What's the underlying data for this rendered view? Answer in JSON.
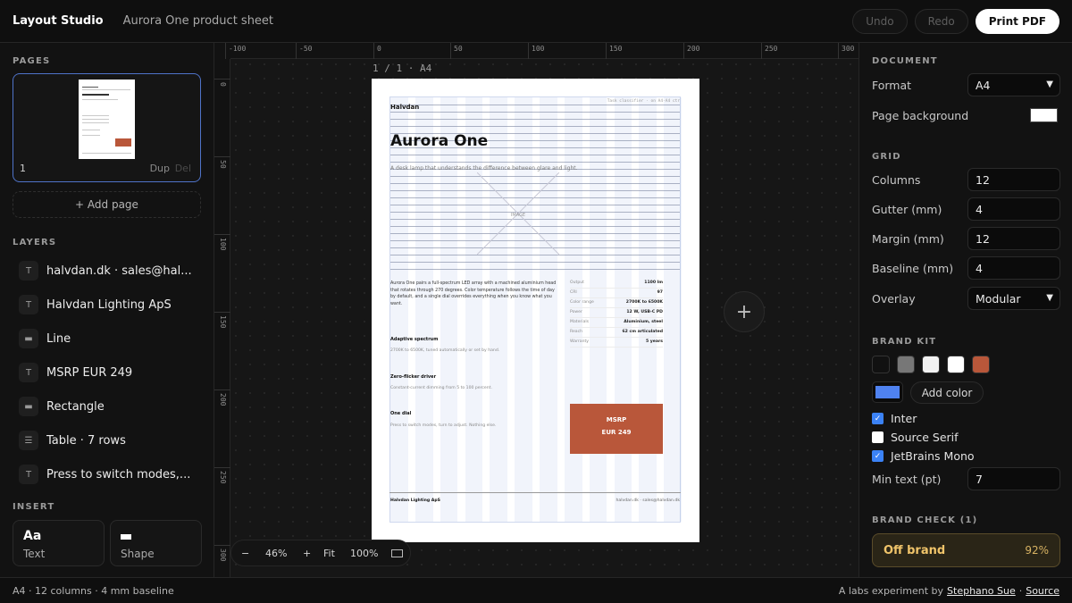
{
  "topbar": {
    "app_title": "Layout Studio",
    "doc_title": "Aurora One product sheet",
    "undo_label": "Undo",
    "redo_label": "Redo",
    "print_label": "Print PDF"
  },
  "pages": {
    "section_label": "PAGES",
    "items": [
      {
        "number": "1",
        "dup_label": "Dup",
        "del_label": "Del"
      }
    ],
    "add_label": "+ Add page"
  },
  "layers": {
    "section_label": "LAYERS",
    "items": [
      {
        "icon": "T",
        "label": "halvdan.dk · sales@hal..."
      },
      {
        "icon": "T",
        "label": "Halvdan Lighting ApS"
      },
      {
        "icon": "▬",
        "label": "Line"
      },
      {
        "icon": "T",
        "label": "MSRP EUR 249"
      },
      {
        "icon": "▬",
        "label": "Rectangle"
      },
      {
        "icon": "☰",
        "label": "Table · 7 rows"
      },
      {
        "icon": "T",
        "label": "Press to switch modes,..."
      }
    ]
  },
  "insert": {
    "section_label": "INSERT",
    "items": [
      {
        "glyph": "Aa",
        "label": "Text"
      },
      {
        "glyph": "",
        "label": "Shape"
      }
    ]
  },
  "canvas": {
    "ruler_top": [
      "-100",
      "-50",
      "0",
      "50",
      "100",
      "150",
      "200",
      "250",
      "300"
    ],
    "ruler_left": [
      "0",
      "50",
      "100",
      "150",
      "200",
      "250",
      "300"
    ],
    "page_indicator": "1 / 1 · A4",
    "fab_label": "+",
    "zoom": {
      "minus": "−",
      "value": "46%",
      "plus": "+",
      "fit": "Fit",
      "actual": "100%"
    }
  },
  "sheet": {
    "brand": "Halvdan",
    "top_right_tag": "Task classifier · on A4·A4 ctr",
    "title": "Aurora One",
    "subtitle": "A desk lamp that understands the difference between glare and light.",
    "image_label": "IMAGE",
    "body": "Aurora One pairs a full-spectrum LED array with a machined aluminium head that rotates through 270 degrees. Color temperature follows the time of day by default, and a single dial overrides everything when you know what you want.",
    "features": [
      {
        "title": "Adaptive spectrum",
        "text": "2700K to 6500K, tuned automatically or set by hand."
      },
      {
        "title": "Zero-flicker driver",
        "text": "Constant-current dimming from 5 to 100 percent."
      },
      {
        "title": "One dial",
        "text": "Press to switch modes, turn to adjust. Nothing else."
      }
    ],
    "specs": [
      {
        "label": "Output",
        "value": "1100 lm"
      },
      {
        "label": "CRI",
        "value": "97"
      },
      {
        "label": "Color range",
        "value": "2700K to 6500K"
      },
      {
        "label": "Power",
        "value": "12 W, USB-C PD"
      },
      {
        "label": "Materials",
        "value": "Aluminium, steel"
      },
      {
        "label": "Reach",
        "value": "62 cm articulated"
      },
      {
        "label": "Warranty",
        "value": "5 years"
      }
    ],
    "price_line1": "MSRP",
    "price_line2": "EUR 249",
    "footer_left": "Halvdan Lighting ApS",
    "footer_right": "halvdan.dk · sales@halvdan.dk",
    "accent_color": "#b9573a"
  },
  "document": {
    "section_label": "DOCUMENT",
    "format_label": "Format",
    "format_value": "A4",
    "background_label": "Page background",
    "background_color": "#ffffff"
  },
  "grid": {
    "section_label": "GRID",
    "columns_label": "Columns",
    "columns_value": "12",
    "gutter_label": "Gutter (mm)",
    "gutter_value": "4",
    "margin_label": "Margin (mm)",
    "margin_value": "12",
    "baseline_label": "Baseline (mm)",
    "baseline_value": "4",
    "overlay_label": "Overlay",
    "overlay_value": "Modular"
  },
  "brand_kit": {
    "section_label": "BRAND KIT",
    "swatches": [
      "#111111",
      "#777777",
      "#f2f2f2",
      "#ffffff",
      "#b9573a"
    ],
    "selected_color": "#4f82f0",
    "add_color_label": "Add color",
    "fonts": [
      {
        "name": "Inter",
        "checked": true
      },
      {
        "name": "Source Serif",
        "checked": false
      },
      {
        "name": "JetBrains Mono",
        "checked": true
      }
    ],
    "min_text_label": "Min text (pt)",
    "min_text_value": "7"
  },
  "brand_check": {
    "section_label": "BRAND CHECK (1)",
    "status": "Off brand",
    "score": "92%"
  },
  "statusbar": {
    "left": "A4 · 12 columns · 4 mm baseline",
    "credit_prefix": "A labs experiment by",
    "author": "Stephano Sue",
    "separator": "·",
    "source_label": "Source"
  }
}
